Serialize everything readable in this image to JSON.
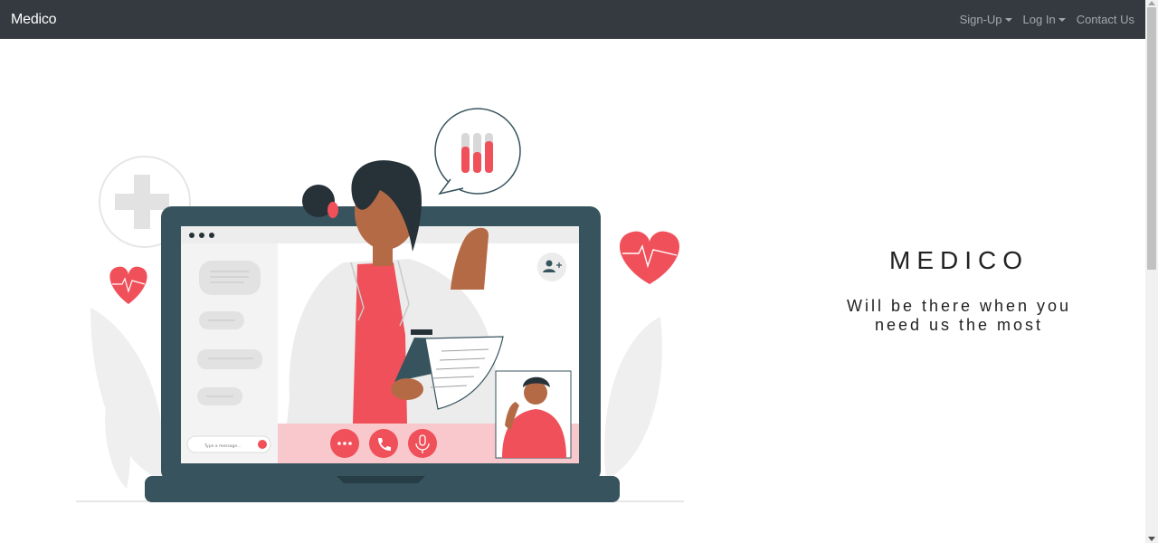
{
  "navbar": {
    "brand": "Medico",
    "links": [
      {
        "label": "Sign-Up",
        "dropdown": true
      },
      {
        "label": "Log In",
        "dropdown": true
      },
      {
        "label": "Contact Us",
        "dropdown": false
      }
    ]
  },
  "hero": {
    "title": "MEDICO",
    "tagline_line1": "Will be there when you",
    "tagline_line2": "need us the most"
  },
  "chat": {
    "input_placeholder": "Type a message..."
  },
  "colors": {
    "navbar_bg": "#343a40",
    "accent_red": "#f0505a",
    "laptop": "#37545e"
  }
}
